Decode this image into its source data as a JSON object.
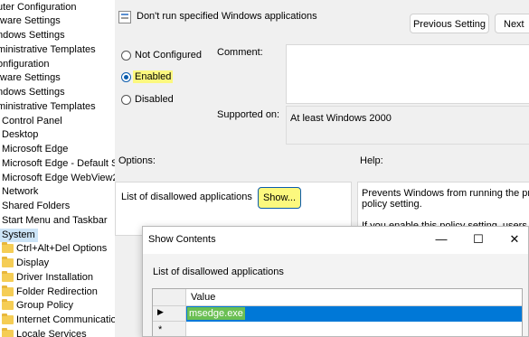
{
  "tree": {
    "items": [
      {
        "label": "uter Configuration",
        "folder": false
      },
      {
        "label": "tware Settings",
        "folder": false
      },
      {
        "label": "ndows Settings",
        "folder": false
      },
      {
        "label": "ministrative Templates",
        "folder": false
      },
      {
        "label": "onfiguration",
        "folder": false
      },
      {
        "label": "tware Settings",
        "folder": false
      },
      {
        "label": "ndows Settings",
        "folder": false
      },
      {
        "label": "ministrative Templates",
        "folder": false
      },
      {
        "label": "Control Panel",
        "folder": false
      },
      {
        "label": "Desktop",
        "folder": false
      },
      {
        "label": "Microsoft Edge",
        "folder": false
      },
      {
        "label": "Microsoft Edge - Default Se",
        "folder": false
      },
      {
        "label": "Microsoft Edge WebView2",
        "folder": false
      },
      {
        "label": "Network",
        "folder": false
      },
      {
        "label": "Shared Folders",
        "folder": false
      },
      {
        "label": "Start Menu and Taskbar",
        "folder": false
      },
      {
        "label": "System",
        "folder": false,
        "selected": true
      },
      {
        "label": "Ctrl+Alt+Del Options",
        "folder": true
      },
      {
        "label": "Display",
        "folder": true
      },
      {
        "label": "Driver Installation",
        "folder": true
      },
      {
        "label": "Folder Redirection",
        "folder": true
      },
      {
        "label": "Group Policy",
        "folder": true
      },
      {
        "label": "Internet Communicatio",
        "folder": true
      },
      {
        "label": "Locale Services",
        "folder": true
      }
    ]
  },
  "policy": {
    "title": "Don't run specified Windows applications",
    "previous_setting": "Previous Setting",
    "next_setting": "Next",
    "radio_not_configured": "Not Configured",
    "radio_enabled": "Enabled",
    "radio_disabled": "Disabled",
    "comment_label": "Comment:",
    "supported_label": "Supported on:",
    "supported_value": "At least Windows 2000",
    "options_label": "Options:",
    "help_label": "Help:",
    "list_label": "List of disallowed applications",
    "show_button": "Show...",
    "help_line1": "Prevents Windows from running the pro",
    "help_line2": "policy setting.",
    "help_line3": "If you enable this policy setting, users ca"
  },
  "show_contents": {
    "title": "Show Contents",
    "minimize": "—",
    "maximize": "☐",
    "close": "✕",
    "list_label": "List of disallowed applications",
    "column_header": "Value",
    "row_marker": "▶",
    "new_row_marker": "*",
    "rows": [
      "msedge.exe"
    ]
  },
  "colors": {
    "highlight": "#fcf87e",
    "selection_blue": "#0078d7",
    "text_highlight_green": "#6abf52"
  }
}
